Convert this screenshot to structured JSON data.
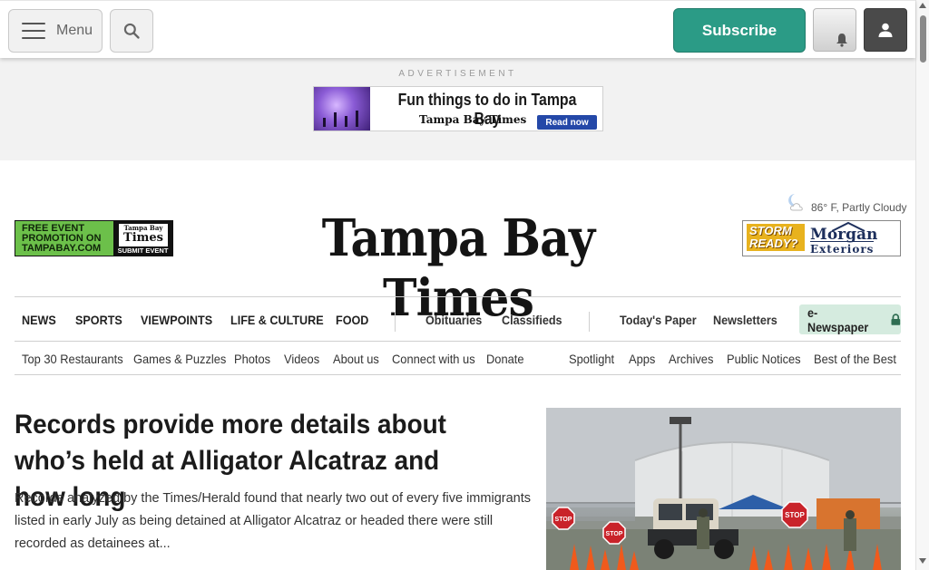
{
  "header": {
    "menu_label": "Menu",
    "search_icon": "search-icon",
    "subscribe_label": "Subscribe",
    "bell_icon": "bell-icon",
    "user_icon": "user-icon",
    "accent_color": "#2b9b86"
  },
  "ad": {
    "label": "ADVERTISEMENT",
    "headline": "Fun things to do in Tampa Bay",
    "brand": "Tampa Bay Times",
    "cta": "Read now"
  },
  "masthead": {
    "logo_text": "Tampa Bay Times",
    "weather": "86° F, Partly Cloudy",
    "weather_icon": "partly-cloudy-icon",
    "promo_left": {
      "line1": "FREE EVENT",
      "line2": "PROMOTION ON",
      "line3": "TAMPABAY.COM",
      "badge_top": "Tampa Bay",
      "badge_main": "Times",
      "badge_action": "SUBMIT EVENT"
    },
    "promo_right": {
      "line1": "STORM",
      "line2": "READY?",
      "brand": "Morgan",
      "brand_sub": "Exteriors"
    }
  },
  "nav_primary": {
    "sections": [
      "NEWS",
      "SPORTS",
      "VIEWPOINTS",
      "LIFE & CULTURE",
      "FOOD"
    ],
    "secondary": [
      "Obituaries",
      "Classifieds"
    ],
    "tertiary": [
      "Today's Paper",
      "Newsletters"
    ],
    "enewspaper": "e-Newspaper",
    "enewspaper_icon": "lock-icon"
  },
  "nav_secondary": {
    "left": [
      "Top 30 Restaurants",
      "Games & Puzzles",
      "Photos",
      "Videos",
      "About us",
      "Connect with us",
      "Donate"
    ],
    "right": [
      "Spotlight",
      "Apps",
      "Archives",
      "Public Notices",
      "Best of the Best"
    ]
  },
  "article": {
    "headline": "Records provide more details about who’s held at Alligator Alcatraz and how long",
    "summary": "Records analyzed by the Times/Herald found that nearly two out of every five immigrants listed in early July as being detained at Alligator Alcatraz or headed there were still recorded as detainees at...",
    "photo_signs": [
      "STOP",
      "STOP",
      "STOP"
    ]
  }
}
